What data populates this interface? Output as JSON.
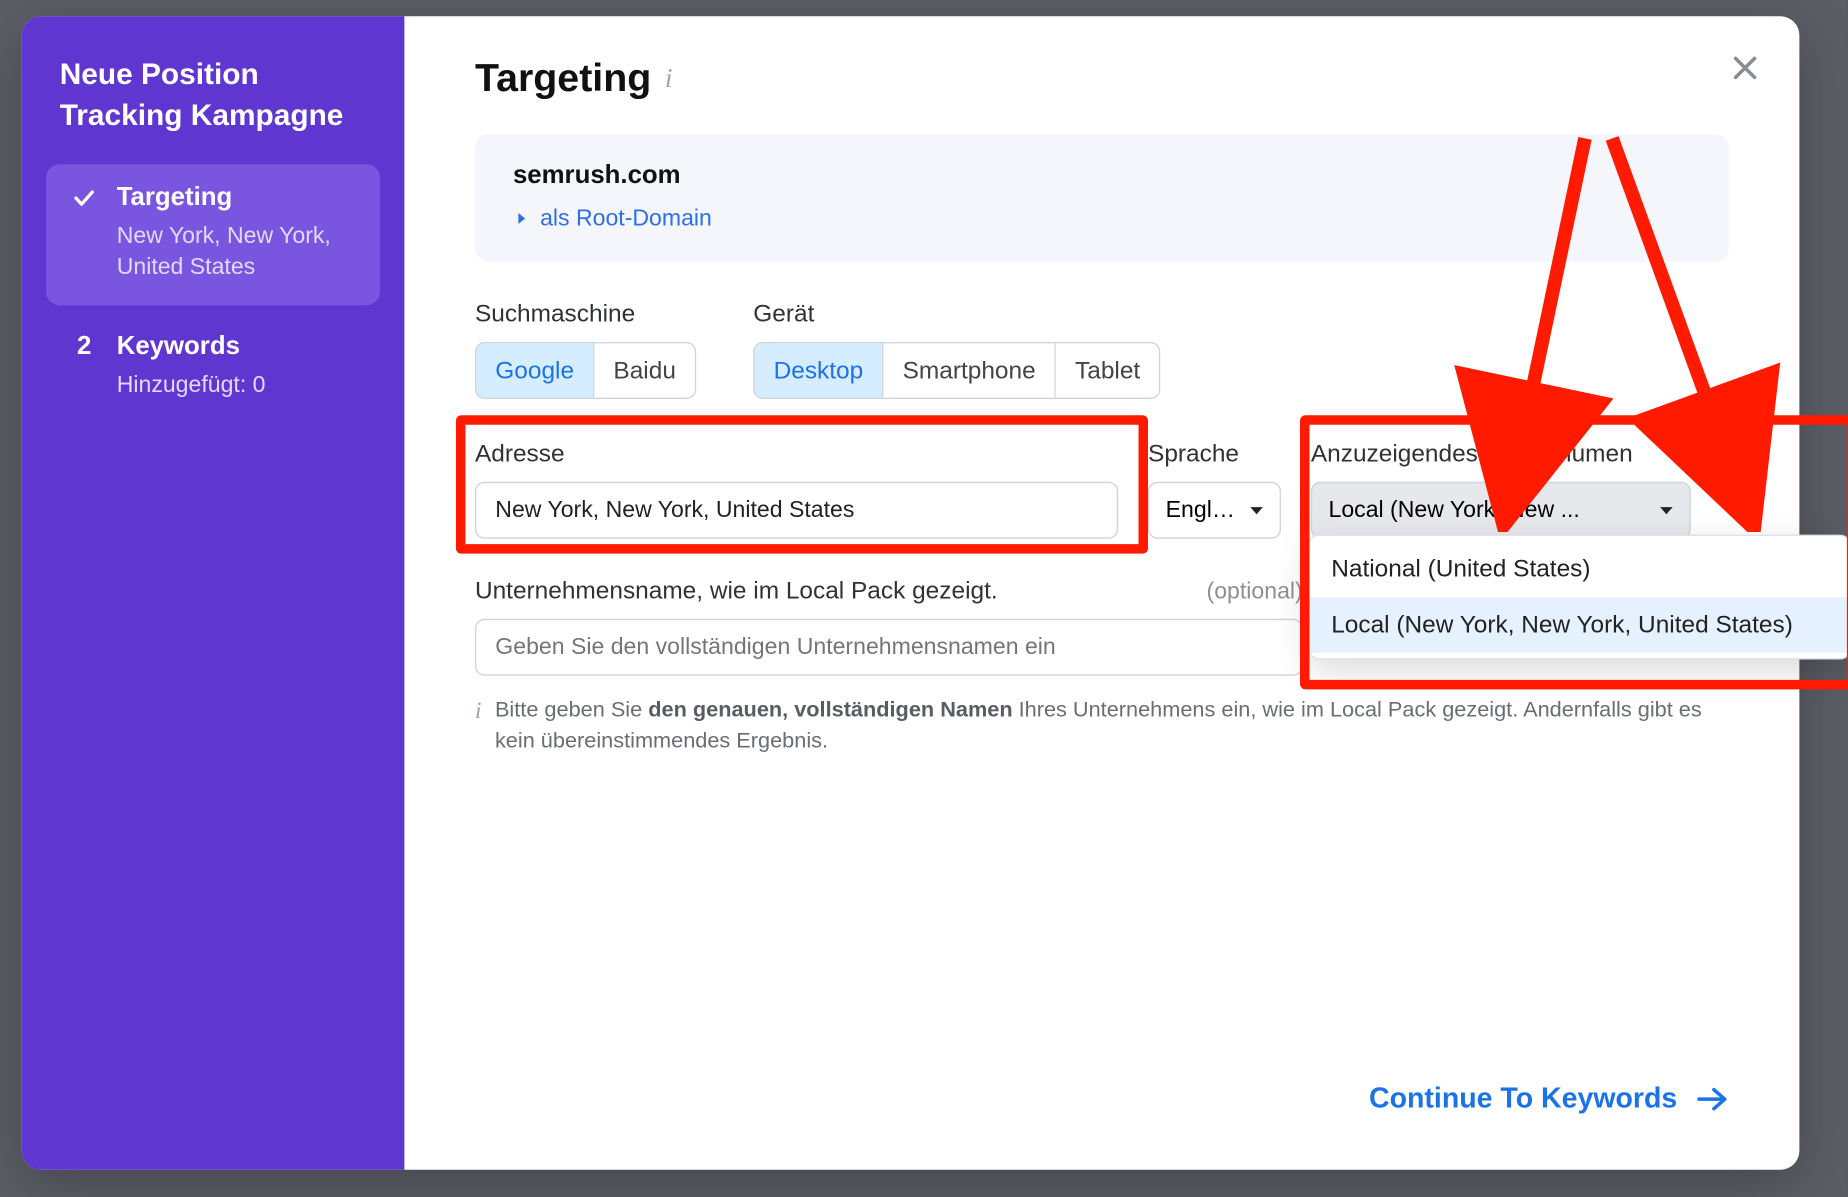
{
  "sidebar": {
    "title": "Neue Position Tracking Kampagne",
    "steps": [
      {
        "label": "Targeting",
        "sub": "New York, New York, United States"
      },
      {
        "num": "2",
        "label": "Keywords",
        "sub": "Hinzugefügt: 0"
      }
    ]
  },
  "main": {
    "title": "Targeting",
    "domain": {
      "name": "semrush.com",
      "linkLabel": "als Root-Domain"
    },
    "searchEngine": {
      "label": "Suchmaschine",
      "options": [
        "Google",
        "Baidu"
      ]
    },
    "device": {
      "label": "Gerät",
      "options": [
        "Desktop",
        "Smartphone",
        "Tablet"
      ]
    },
    "address": {
      "label": "Adresse",
      "value": "New York, New York, United States"
    },
    "language": {
      "label": "Sprache",
      "value": "English"
    },
    "volume": {
      "label": "Anzuzeigendes Suchvolumen",
      "selected": "Local (New York, New ...",
      "options": [
        "National (United States)",
        "Local (New York, New York, United States)"
      ]
    },
    "business": {
      "label": "Unternehmensname, wie im Local Pack gezeigt.",
      "optional": "(optional)",
      "placeholder": "Geben Sie den vollständigen Unternehmensnamen ein",
      "help_pre": "Bitte geben Sie ",
      "help_bold": "den genauen, vollständigen Namen",
      "help_post": " Ihres Unternehmens ein, wie im Local Pack gezeigt. Andernfalls gibt es kein übereinstimmendes Ergebnis."
    },
    "continue": "Continue To Keywords"
  }
}
